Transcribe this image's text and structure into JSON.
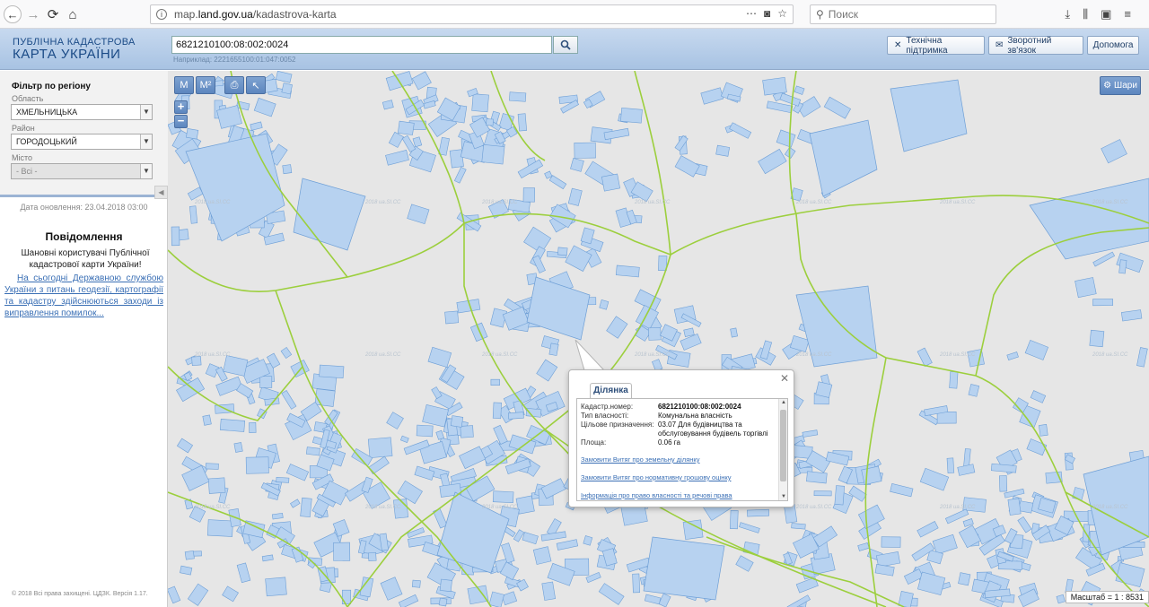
{
  "browser": {
    "url_prefix": "map.",
    "url_domain": "land.gov.ua",
    "url_path": "/kadastrova-karta",
    "search_placeholder": "Поиск"
  },
  "header": {
    "logo_line1": "ПУБЛІЧНА КАДАСТРОВА",
    "logo_line2": "КАРТА УКРАЇНИ",
    "search_value": "6821210100:08:002:0024",
    "search_example": "Наприклад: 2221655100:01:047:0052",
    "btn_support": "Технічна підтримка",
    "btn_feedback": "Зворотний зв'язок",
    "btn_help": "Допомога"
  },
  "sidebar": {
    "filter_title": "Фільтр по регіону",
    "oblast_label": "Область",
    "oblast_value": "ХМЕЛЬНИЦЬКА",
    "rayon_label": "Район",
    "rayon_value": "ГОРОДОЦЬКИЙ",
    "misto_label": "Місто",
    "misto_value": "- Всі -",
    "updated": "Дата оновлення: 23.04.2018 03:00",
    "notice_title": "Повідомлення",
    "notice_text": "Шановні користувачі Публічної кадастрової карти України!",
    "notice_link": "На сьогодні Державною службою України з питань геодезії, картографії та кадастру здійснюються заходи із виправлення помилок...",
    "copyright": "© 2018 Всі права захищені. ЦДЗК. Версія 1.17."
  },
  "map": {
    "layers_label": "Шари",
    "scale_text": "Масштаб = 1 : 8531",
    "watermark": "2018 ua.SI.CC",
    "tools": {
      "t1": "M",
      "t2": "M²"
    }
  },
  "popup": {
    "tab": "Ділянка",
    "rows": [
      {
        "k": "Кадастр.номер:",
        "v": "6821210100:08:002:0024"
      },
      {
        "k": "Тип власності:",
        "v": "Комунальна власність"
      },
      {
        "k": "Цільове призначення:",
        "v": "03.07 Для будівництва та обслуговування будівель торгівлі"
      },
      {
        "k": "Площа:",
        "v": "0.06 га"
      }
    ],
    "link1": "Замовити Витяг про земельну ділянку",
    "link2": "Замовити Витяг про нормативну грошову оцінку",
    "link3": "Інформація про право власності та речові права"
  },
  "colors": {
    "parcel_fill": "#b7d2f0",
    "parcel_stroke": "#6e9fd6",
    "boundary": "#9ccf3d",
    "map_bg": "#e6e6e6"
  }
}
